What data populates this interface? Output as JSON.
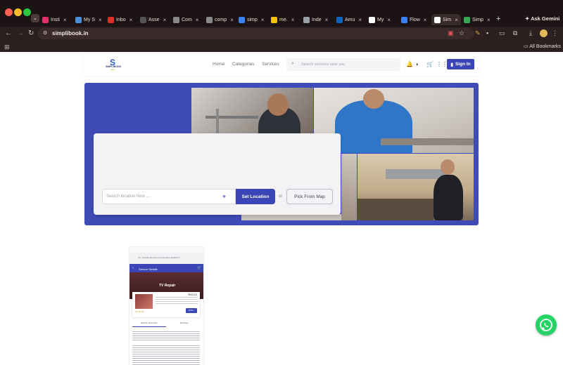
{
  "browser": {
    "tabs": [
      {
        "label": "Insti",
        "icon": "instagram-icon",
        "color": "#e1306c"
      },
      {
        "label": "My S",
        "icon": "drive-icon",
        "color": "#4a90d9"
      },
      {
        "label": "Inbo",
        "icon": "gmail-icon",
        "color": "#d93025"
      },
      {
        "label": "Asse",
        "icon": "asset-icon",
        "color": "#555555"
      },
      {
        "label": "Com",
        "icon": "diamond-icon",
        "color": "#888888"
      },
      {
        "label": "comp",
        "icon": "diamond-icon",
        "color": "#888888"
      },
      {
        "label": "simp",
        "icon": "app-icon",
        "color": "#3b82f6"
      },
      {
        "label": "me.",
        "icon": "app-icon",
        "color": "#f4c20d"
      },
      {
        "label": "Inde",
        "icon": "globe-icon",
        "color": "#9aa0a6"
      },
      {
        "label": "Amu",
        "icon": "linkedin-icon",
        "color": "#0a66c2"
      },
      {
        "label": "My",
        "icon": "info-icon",
        "color": "#ffffff"
      },
      {
        "label": "Flow",
        "icon": "app-icon",
        "color": "#3b82f6"
      },
      {
        "label": "Sim",
        "icon": "simplibook-icon",
        "color": "#ffffff",
        "active": true
      },
      {
        "label": "Simp",
        "icon": "play-icon",
        "color": "#34a853"
      }
    ],
    "ask_gemini": "Ask Gemini",
    "url": "simplibook.in",
    "all_bookmarks": "All Bookmarks"
  },
  "site": {
    "logo_text": "SIMPLIBOOK",
    "logo_sub": "Infra",
    "nav": [
      "Home",
      "Categories",
      "Services"
    ],
    "search_placeholder": "Search services near you",
    "signin_label": "Sign In"
  },
  "hero": {
    "location_placeholder": "Search location here ....",
    "set_location": "Set Location",
    "or": "or",
    "pick_from_map": "Pick From Map"
  },
  "phone_preview": {
    "url": "Tip: simplibook.in/services/service-details/TV",
    "bar_title": "Service Details",
    "banner_title": "TV Repair",
    "price": "₹543.00",
    "rating": "★ 4.2 (4)",
    "add_label": "ADD +",
    "tab_1": "Service Overview",
    "tab_2": "Reviews"
  },
  "colors": {
    "brand_blue": "#3b45b5",
    "whatsapp_green": "#25d366"
  }
}
